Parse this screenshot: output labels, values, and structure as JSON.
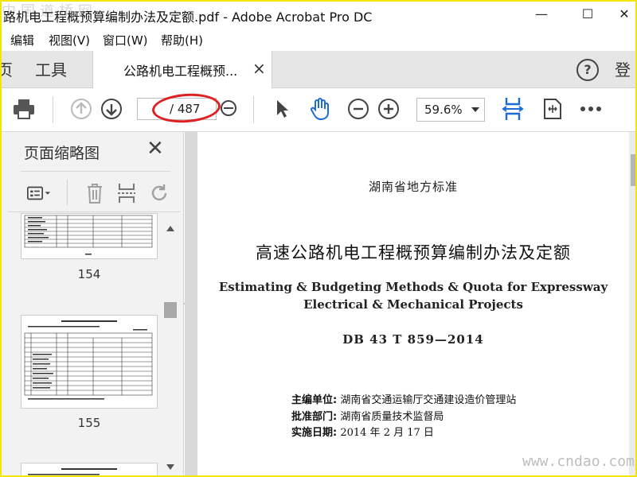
{
  "window": {
    "title": "路机电工程概预算编制办法及定额.pdf - Adobe Acrobat Pro DC",
    "watermark_topleft": "中国道桥网",
    "controls": {
      "minimize": "—",
      "maximize": "☐",
      "close": "✕"
    }
  },
  "menu": [
    "编辑",
    "视图(V)",
    "窗口(W)",
    "帮助(H)"
  ],
  "tabs": {
    "home": "页",
    "tools": "工具",
    "document": "公路机电工程概预...",
    "close": "×",
    "help": "?",
    "login": "登"
  },
  "toolbar": {
    "page_current": "",
    "page_total": "/ 487",
    "zoom": "59.6%"
  },
  "panel": {
    "title": "页面缩略图",
    "close": "✕",
    "thumbnails": [
      {
        "page": "154"
      },
      {
        "page": "155"
      }
    ]
  },
  "document": {
    "standard_type": "湖南省地方标准",
    "title_cn": "高速公路机电工程概预算编制办法及定额",
    "title_en_line1": "Estimating & Budgeting Methods & Quota for Expressway",
    "title_en_line2": "Electrical & Mechanical Projects",
    "code": "DB 43 T 859—2014",
    "editor_label": "主编单位:",
    "editor_value": "湖南省交通运输厅交通建设造价管理站",
    "approver_label": "批准部门:",
    "approver_value": "湖南省质量技术监督局",
    "date_label": "实施日期:",
    "date_value": "2014 年 2 月 17 日"
  },
  "watermark_bottomright": "www.cndao.com",
  "colors": {
    "accent_blue": "#1d6bd6",
    "annotation_red": "#e02020",
    "window_border": "#f2e600"
  }
}
